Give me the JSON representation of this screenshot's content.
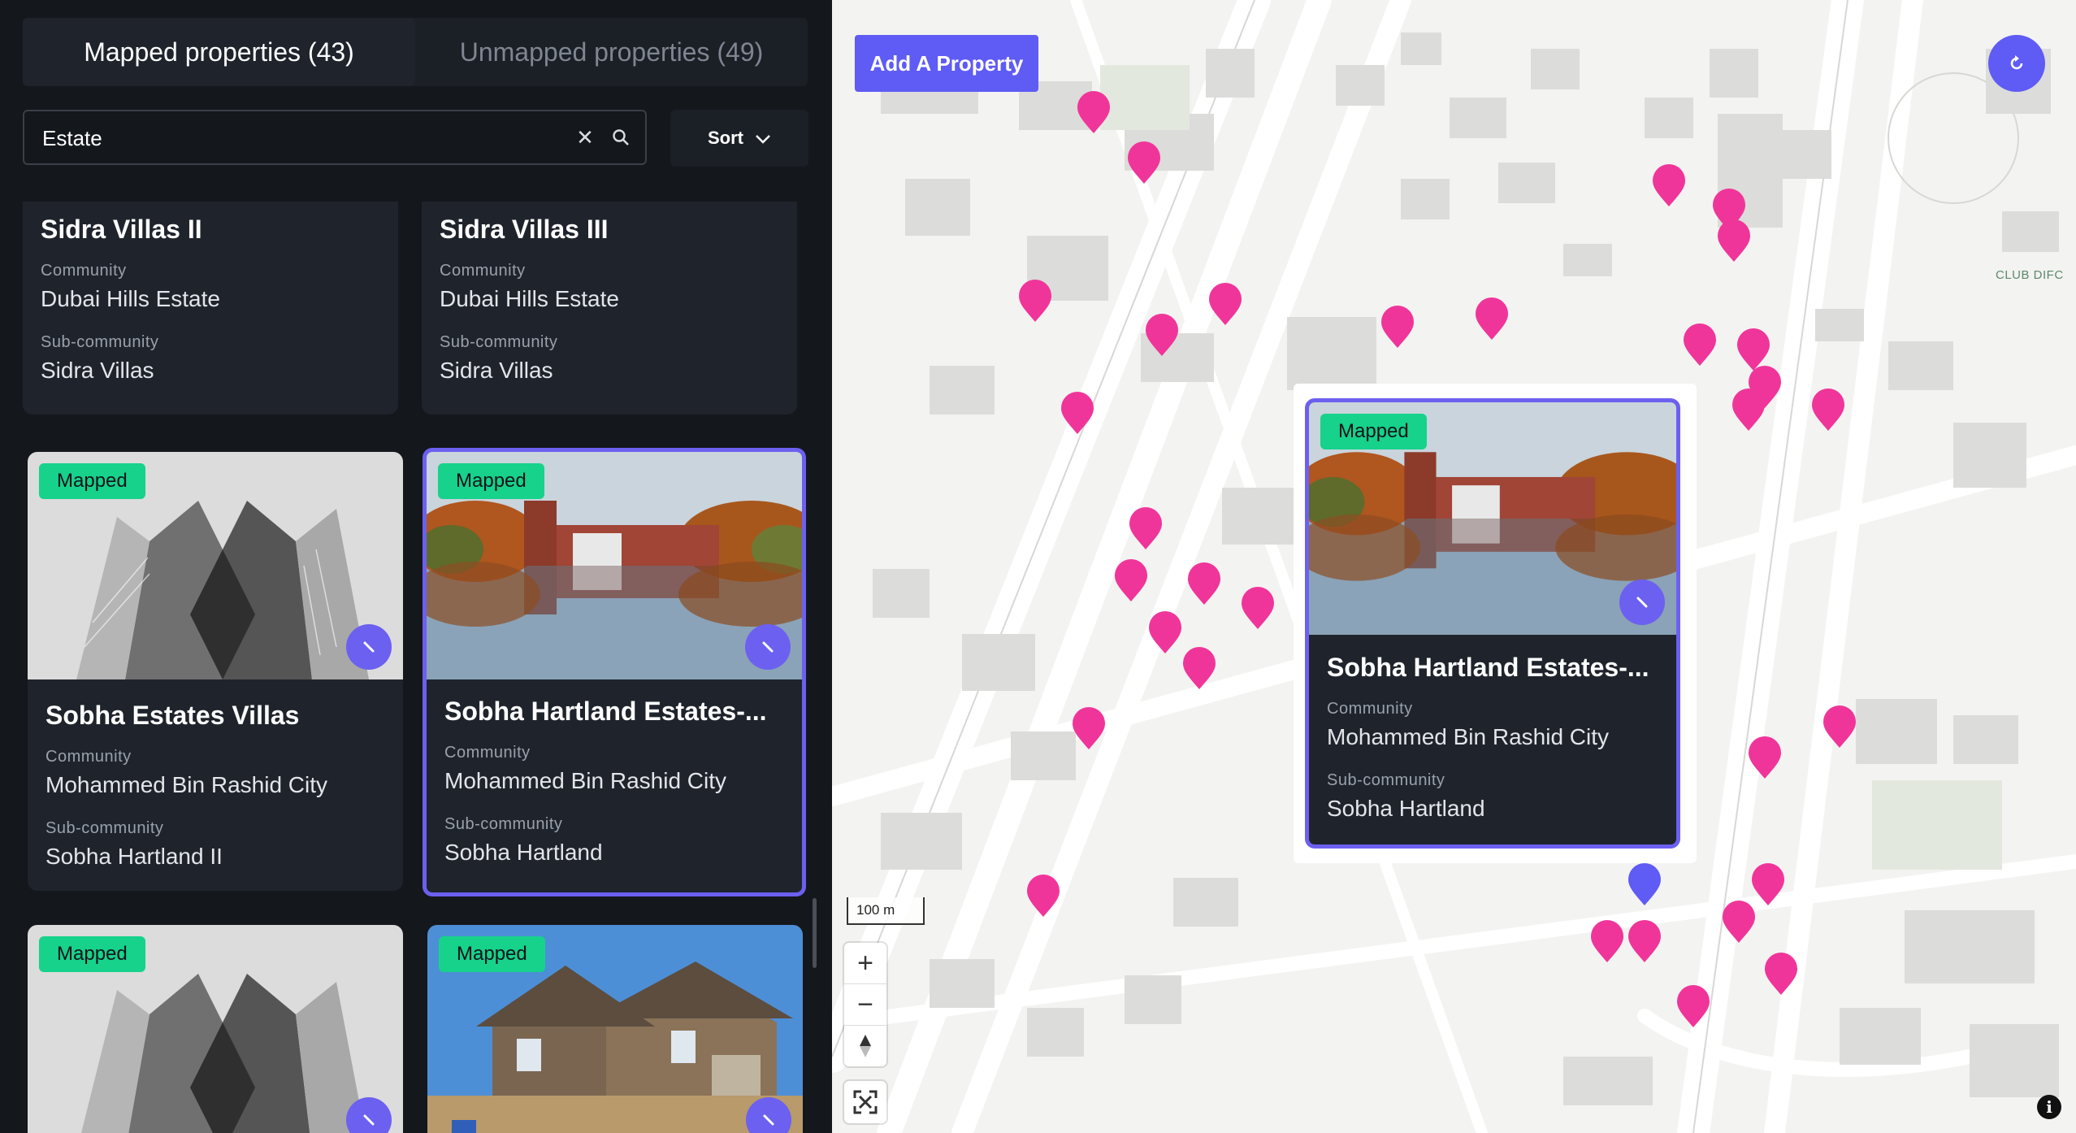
{
  "tabs": {
    "mapped": "Mapped properties (43)",
    "unmapped": "Unmapped properties (49)"
  },
  "search": {
    "value": "Estate",
    "clear_icon": "close-icon",
    "search_icon": "search-icon"
  },
  "sort": {
    "label": "Sort"
  },
  "labels": {
    "community": "Community",
    "subcommunity": "Sub-community",
    "badge": "Mapped"
  },
  "cards": [
    {
      "title": "Sidra Villas II",
      "community": "Dubai Hills Estate",
      "subcommunity": "Sidra Villas"
    },
    {
      "title": "Sidra Villas III",
      "community": "Dubai Hills Estate",
      "subcommunity": "Sidra Villas"
    },
    {
      "title": "Sobha Estates Villas",
      "community": "Mohammed Bin Rashid City",
      "subcommunity": "Sobha Hartland II",
      "badge": "Mapped"
    },
    {
      "title": "Sobha Hartland Estates-...",
      "community": "Mohammed Bin Rashid City",
      "subcommunity": "Sobha Hartland",
      "badge": "Mapped"
    },
    {
      "badge": "Mapped"
    },
    {
      "badge": "Mapped"
    }
  ],
  "map": {
    "add_button": "Add A Property",
    "refresh_icon": "refresh-icon",
    "place_label": "CLUB DIFC",
    "scale": "100 m",
    "zoom_in": "+",
    "zoom_out": "−",
    "info": "i",
    "pin_color": "#f0359a",
    "selected_pin_color": "#5f5bf5",
    "popup": {
      "title": "Sobha Hartland Estates-...",
      "community": "Mohammed Bin Rashid City",
      "subcommunity": "Sobha Hartland",
      "badge": "Mapped"
    }
  },
  "colors": {
    "accent": "#6c60f0",
    "badge": "#16d28b",
    "panel": "#14171c",
    "card": "#1f242c"
  }
}
